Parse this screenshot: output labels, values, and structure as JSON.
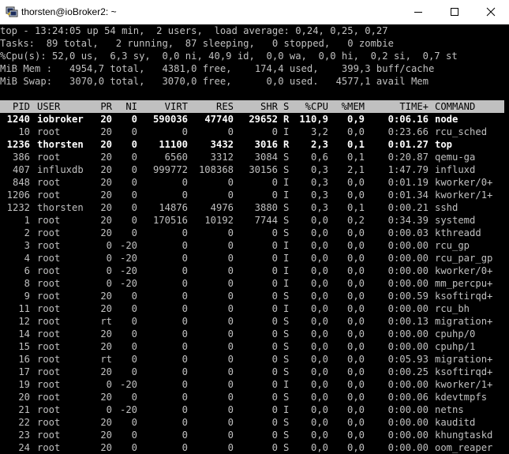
{
  "window": {
    "title": "thorsten@ioBroker2: ~"
  },
  "summary": [
    "top - 13:24:05 up 54 min,  2 users,  load average: 0,24, 0,25, 0,27",
    "Tasks:  89 total,   2 running,  87 sleeping,   0 stopped,   0 zombie",
    "%Cpu(s): 52,0 us,  6,3 sy,  0,0 ni, 40,9 id,  0,0 wa,  0,0 hi,  0,2 si,  0,7 st",
    "MiB Mem :   4954,7 total,   4381,0 free,    174,4 used,    399,3 buff/cache",
    "MiB Swap:   3070,0 total,   3070,0 free,      0,0 used.   4577,1 avail Mem"
  ],
  "columns": [
    "PID",
    "USER",
    "PR",
    "NI",
    "VIRT",
    "RES",
    "SHR",
    "S",
    "%CPU",
    "%MEM",
    "TIME+",
    "COMMAND"
  ],
  "processes": [
    {
      "pid": "1240",
      "user": "iobroker",
      "pr": "20",
      "ni": "0",
      "virt": "590036",
      "res": "47740",
      "shr": "29652",
      "s": "R",
      "cpu": "110,9",
      "mem": "0,9",
      "time": "0:06.16",
      "cmd": "node",
      "bold": true
    },
    {
      "pid": "10",
      "user": "root",
      "pr": "20",
      "ni": "0",
      "virt": "0",
      "res": "0",
      "shr": "0",
      "s": "I",
      "cpu": "3,2",
      "mem": "0,0",
      "time": "0:23.66",
      "cmd": "rcu_sched",
      "bold": false
    },
    {
      "pid": "1236",
      "user": "thorsten",
      "pr": "20",
      "ni": "0",
      "virt": "11100",
      "res": "3432",
      "shr": "3016",
      "s": "R",
      "cpu": "2,3",
      "mem": "0,1",
      "time": "0:01.27",
      "cmd": "top",
      "bold": true
    },
    {
      "pid": "386",
      "user": "root",
      "pr": "20",
      "ni": "0",
      "virt": "6560",
      "res": "3312",
      "shr": "3084",
      "s": "S",
      "cpu": "0,6",
      "mem": "0,1",
      "time": "0:20.87",
      "cmd": "qemu-ga",
      "bold": false
    },
    {
      "pid": "407",
      "user": "influxdb",
      "pr": "20",
      "ni": "0",
      "virt": "999772",
      "res": "108368",
      "shr": "30156",
      "s": "S",
      "cpu": "0,3",
      "mem": "2,1",
      "time": "1:47.79",
      "cmd": "influxd",
      "bold": false
    },
    {
      "pid": "848",
      "user": "root",
      "pr": "20",
      "ni": "0",
      "virt": "0",
      "res": "0",
      "shr": "0",
      "s": "I",
      "cpu": "0,3",
      "mem": "0,0",
      "time": "0:01.19",
      "cmd": "kworker/0+",
      "bold": false
    },
    {
      "pid": "1206",
      "user": "root",
      "pr": "20",
      "ni": "0",
      "virt": "0",
      "res": "0",
      "shr": "0",
      "s": "I",
      "cpu": "0,3",
      "mem": "0,0",
      "time": "0:01.34",
      "cmd": "kworker/1+",
      "bold": false
    },
    {
      "pid": "1232",
      "user": "thorsten",
      "pr": "20",
      "ni": "0",
      "virt": "14876",
      "res": "4976",
      "shr": "3880",
      "s": "S",
      "cpu": "0,3",
      "mem": "0,1",
      "time": "0:00.21",
      "cmd": "sshd",
      "bold": false
    },
    {
      "pid": "1",
      "user": "root",
      "pr": "20",
      "ni": "0",
      "virt": "170516",
      "res": "10192",
      "shr": "7744",
      "s": "S",
      "cpu": "0,0",
      "mem": "0,2",
      "time": "0:34.39",
      "cmd": "systemd",
      "bold": false
    },
    {
      "pid": "2",
      "user": "root",
      "pr": "20",
      "ni": "0",
      "virt": "0",
      "res": "0",
      "shr": "0",
      "s": "S",
      "cpu": "0,0",
      "mem": "0,0",
      "time": "0:00.03",
      "cmd": "kthreadd",
      "bold": false
    },
    {
      "pid": "3",
      "user": "root",
      "pr": "0",
      "ni": "-20",
      "virt": "0",
      "res": "0",
      "shr": "0",
      "s": "I",
      "cpu": "0,0",
      "mem": "0,0",
      "time": "0:00.00",
      "cmd": "rcu_gp",
      "bold": false
    },
    {
      "pid": "4",
      "user": "root",
      "pr": "0",
      "ni": "-20",
      "virt": "0",
      "res": "0",
      "shr": "0",
      "s": "I",
      "cpu": "0,0",
      "mem": "0,0",
      "time": "0:00.00",
      "cmd": "rcu_par_gp",
      "bold": false
    },
    {
      "pid": "6",
      "user": "root",
      "pr": "0",
      "ni": "-20",
      "virt": "0",
      "res": "0",
      "shr": "0",
      "s": "I",
      "cpu": "0,0",
      "mem": "0,0",
      "time": "0:00.00",
      "cmd": "kworker/0+",
      "bold": false
    },
    {
      "pid": "8",
      "user": "root",
      "pr": "0",
      "ni": "-20",
      "virt": "0",
      "res": "0",
      "shr": "0",
      "s": "I",
      "cpu": "0,0",
      "mem": "0,0",
      "time": "0:00.00",
      "cmd": "mm_percpu+",
      "bold": false
    },
    {
      "pid": "9",
      "user": "root",
      "pr": "20",
      "ni": "0",
      "virt": "0",
      "res": "0",
      "shr": "0",
      "s": "S",
      "cpu": "0,0",
      "mem": "0,0",
      "time": "0:00.59",
      "cmd": "ksoftirqd+",
      "bold": false
    },
    {
      "pid": "11",
      "user": "root",
      "pr": "20",
      "ni": "0",
      "virt": "0",
      "res": "0",
      "shr": "0",
      "s": "I",
      "cpu": "0,0",
      "mem": "0,0",
      "time": "0:00.00",
      "cmd": "rcu_bh",
      "bold": false
    },
    {
      "pid": "12",
      "user": "root",
      "pr": "rt",
      "ni": "0",
      "virt": "0",
      "res": "0",
      "shr": "0",
      "s": "S",
      "cpu": "0,0",
      "mem": "0,0",
      "time": "0:00.13",
      "cmd": "migration+",
      "bold": false
    },
    {
      "pid": "14",
      "user": "root",
      "pr": "20",
      "ni": "0",
      "virt": "0",
      "res": "0",
      "shr": "0",
      "s": "S",
      "cpu": "0,0",
      "mem": "0,0",
      "time": "0:00.00",
      "cmd": "cpuhp/0",
      "bold": false
    },
    {
      "pid": "15",
      "user": "root",
      "pr": "20",
      "ni": "0",
      "virt": "0",
      "res": "0",
      "shr": "0",
      "s": "S",
      "cpu": "0,0",
      "mem": "0,0",
      "time": "0:00.00",
      "cmd": "cpuhp/1",
      "bold": false
    },
    {
      "pid": "16",
      "user": "root",
      "pr": "rt",
      "ni": "0",
      "virt": "0",
      "res": "0",
      "shr": "0",
      "s": "S",
      "cpu": "0,0",
      "mem": "0,0",
      "time": "0:05.93",
      "cmd": "migration+",
      "bold": false
    },
    {
      "pid": "17",
      "user": "root",
      "pr": "20",
      "ni": "0",
      "virt": "0",
      "res": "0",
      "shr": "0",
      "s": "S",
      "cpu": "0,0",
      "mem": "0,0",
      "time": "0:00.25",
      "cmd": "ksoftirqd+",
      "bold": false
    },
    {
      "pid": "19",
      "user": "root",
      "pr": "0",
      "ni": "-20",
      "virt": "0",
      "res": "0",
      "shr": "0",
      "s": "I",
      "cpu": "0,0",
      "mem": "0,0",
      "time": "0:00.00",
      "cmd": "kworker/1+",
      "bold": false
    },
    {
      "pid": "20",
      "user": "root",
      "pr": "20",
      "ni": "0",
      "virt": "0",
      "res": "0",
      "shr": "0",
      "s": "S",
      "cpu": "0,0",
      "mem": "0,0",
      "time": "0:00.06",
      "cmd": "kdevtmpfs",
      "bold": false
    },
    {
      "pid": "21",
      "user": "root",
      "pr": "0",
      "ni": "-20",
      "virt": "0",
      "res": "0",
      "shr": "0",
      "s": "I",
      "cpu": "0,0",
      "mem": "0,0",
      "time": "0:00.00",
      "cmd": "netns",
      "bold": false
    },
    {
      "pid": "22",
      "user": "root",
      "pr": "20",
      "ni": "0",
      "virt": "0",
      "res": "0",
      "shr": "0",
      "s": "S",
      "cpu": "0,0",
      "mem": "0,0",
      "time": "0:00.00",
      "cmd": "kauditd",
      "bold": false
    },
    {
      "pid": "23",
      "user": "root",
      "pr": "20",
      "ni": "0",
      "virt": "0",
      "res": "0",
      "shr": "0",
      "s": "S",
      "cpu": "0,0",
      "mem": "0,0",
      "time": "0:00.00",
      "cmd": "khungtaskd",
      "bold": false
    },
    {
      "pid": "24",
      "user": "root",
      "pr": "20",
      "ni": "0",
      "virt": "0",
      "res": "0",
      "shr": "0",
      "s": "S",
      "cpu": "0,0",
      "mem": "0,0",
      "time": "0:00.00",
      "cmd": "oom_reaper",
      "bold": false
    }
  ],
  "colors": {
    "terminal_bg": "#000000",
    "terminal_fg": "#c0c0c0",
    "bold_fg": "#ffffff",
    "header_bar_bg": "#c0c0c0"
  },
  "icons": {
    "app": "putty-icon",
    "minimize": "minimize-icon",
    "maximize": "maximize-icon",
    "close": "close-icon"
  }
}
